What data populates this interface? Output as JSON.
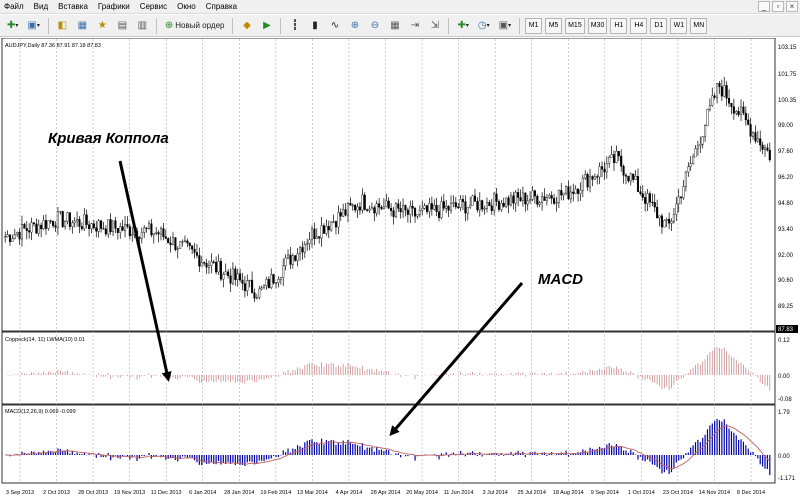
{
  "menu": [
    "Файл",
    "Вид",
    "Вставка",
    "Графики",
    "Сервис",
    "Окно",
    "Справка"
  ],
  "window_controls": [
    "_",
    "▫",
    "×"
  ],
  "toolbar": {
    "new_order_label": "Новый ордер",
    "timeframes": [
      "M1",
      "M5",
      "M15",
      "M30",
      "H1",
      "H4",
      "D1",
      "W1",
      "MN"
    ]
  },
  "chart": {
    "symbol_header": "AUDJPY,Daily  87.36 87.91 87.18 87.83",
    "price_axis": [
      "103.15",
      "101.75",
      "100.35",
      "99.00",
      "97.60",
      "96.20",
      "94.80",
      "93.40",
      "92.00",
      "90.60",
      "89.25"
    ],
    "price_badge": "87.83",
    "coppock": {
      "label": "Coppock(14, 11) LWMA(10) 0.01",
      "axis": [
        "0.12",
        "0.00",
        "-0.08"
      ],
      "bar_color": "#c88a8a"
    },
    "macd": {
      "label": "MACD(12,26,9) 0.069 -0.099",
      "axis": [
        "1.79",
        "0.00",
        "-1.171"
      ],
      "bar_color": "#0000a8",
      "signal_color": "#c06060"
    },
    "date_axis": [
      "3 Sep 2013",
      "2 Oct 2013",
      "28 Oct 2013",
      "19 Nov 2013",
      "11 Dec 2013",
      "6 Jan 2014",
      "28 Jan 2014",
      "19 Feb 2014",
      "13 Mar 2014",
      "4 Apr 2014",
      "28 Apr 2014",
      "20 May 2014",
      "11 Jun 2014",
      "3 Jul 2014",
      "25 Jul 2014",
      "18 Aug 2014",
      "9 Sep 2014",
      "1 Oct 2014",
      "23 Oct 2014",
      "14 Nov 2014",
      "8 Dec 2014"
    ],
    "annotations": {
      "coppock": "Кривая Коппола",
      "macd": "MACD"
    },
    "colors": {
      "background": "#ffffff",
      "candle": "#000000",
      "grid": "#9a9a9a",
      "arrow": "#000000"
    }
  },
  "chart_data": {
    "type": "line",
    "title": "AUDJPY,Daily",
    "x": [
      "Sep 2013",
      "Oct 2013",
      "Nov 2013",
      "Dec 2013",
      "Jan 2014",
      "Feb 2014",
      "Mar 2014",
      "Apr 2014",
      "May 2014",
      "Jun 2014",
      "Jul 2014",
      "Aug 2014",
      "Sep 2014",
      "Oct 2014",
      "Nov 2014",
      "Dec 2014"
    ],
    "series": [
      {
        "name": "AUDJPY",
        "values": [
          93.4,
          94.3,
          93.9,
          93.6,
          92.0,
          90.5,
          93.5,
          95.2,
          94.5,
          95.0,
          95.3,
          95.6,
          97.4,
          93.8,
          101.2,
          97.6
        ]
      }
    ],
    "ylim": [
      88.6,
      103.5
    ],
    "xlabel": "",
    "ylabel": ""
  }
}
